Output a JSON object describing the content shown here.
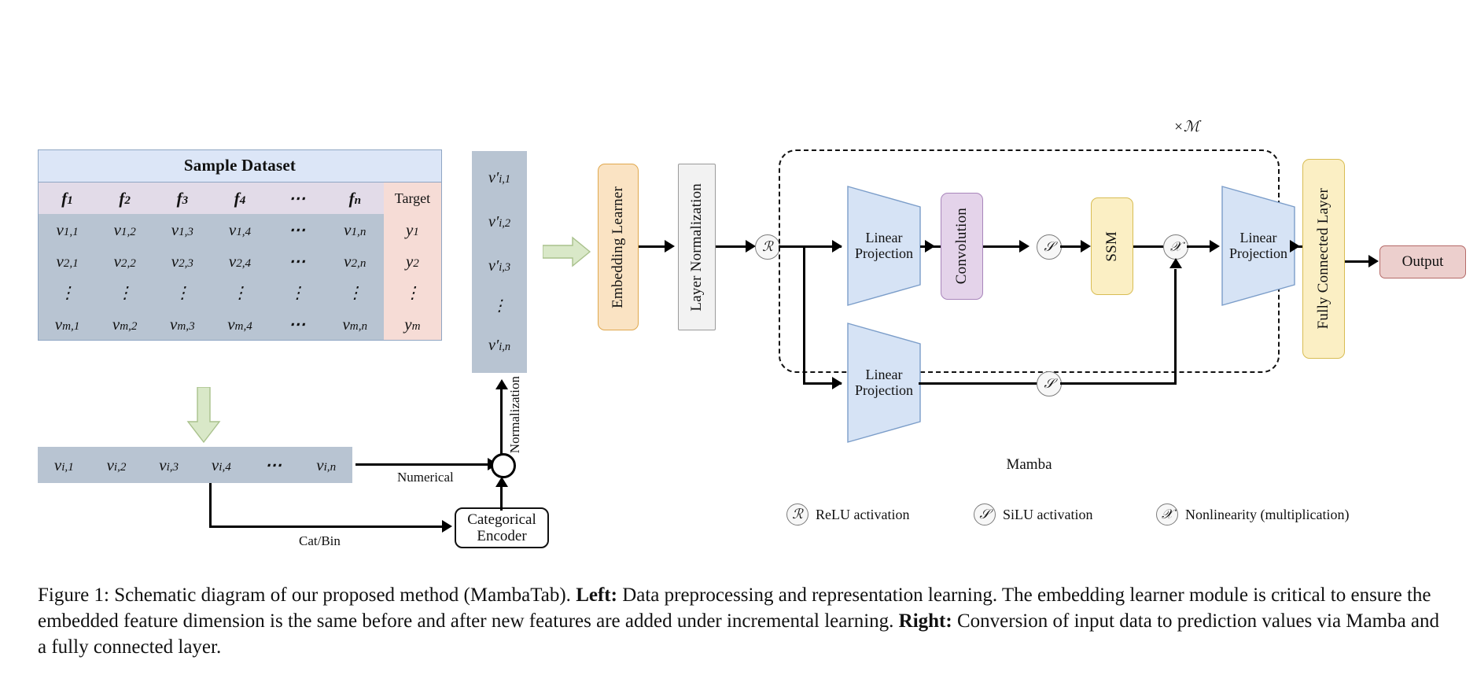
{
  "figure": {
    "caption_parts": {
      "lead": "Figure 1: Schematic diagram of our proposed method (MambaTab). ",
      "left_bold": "Left:",
      "left_text": " Data preprocessing and representation learning. The embedding learner module is critical to ensure the embedded feature dimension is the same before and after new features are added under incremental learning. ",
      "right_bold": "Right:",
      "right_text": " Conversion of input data to prediction values via Mamba and a fully connected layer."
    }
  },
  "dataset": {
    "title": "Sample Dataset",
    "feature_headers": [
      "f₁",
      "f₂",
      "f₃",
      "f₄",
      "⋯",
      "fₙ"
    ],
    "target_header": "Target",
    "rows": [
      {
        "values": [
          "v₁,₁",
          "v₁,₂",
          "v₁,₃",
          "v₁,₄",
          "⋯",
          "v₁,ₙ"
        ],
        "target": "y₁"
      },
      {
        "values": [
          "v₂,₁",
          "v₂,₂",
          "v₂,₃",
          "v₂,₄",
          "⋯",
          "v₂,ₙ"
        ],
        "target": "y₂"
      },
      {
        "values": [
          "⋮",
          "⋮",
          "⋮",
          "⋮",
          "⋮",
          "⋮"
        ],
        "target": "⋮"
      },
      {
        "values": [
          "vₘ,₁",
          "vₘ,₂",
          "vₘ,₃",
          "vₘ,₄",
          "⋯",
          "vₘ,ₙ"
        ],
        "target": "yₘ"
      }
    ]
  },
  "sample_row": {
    "cells": [
      "vᵢ,₁",
      "vᵢ,₂",
      "vᵢ,₃",
      "vᵢ,₄",
      "⋯",
      "vᵢ,ₙ"
    ]
  },
  "preprocess": {
    "numerical_label": "Numerical",
    "catbin_label": "Cat/Bin",
    "categorical_encoder_line1": "Categorical",
    "categorical_encoder_line2": "Encoder",
    "normalization_label": "Normalization"
  },
  "embedded_vector": {
    "cells": [
      "v′ᵢ,₁",
      "v′ᵢ,₂",
      "v′ᵢ,₃",
      "⋮",
      "v′ᵢ,ₙ"
    ]
  },
  "pipeline": {
    "embedding_learner": "Embedding Learner",
    "layer_normalization": "Layer Normalization",
    "relu_node": "ℛ",
    "linear_projection_top_l1": "Linear",
    "linear_projection_top_l2": "Projection",
    "linear_projection_bottom_l1": "Linear",
    "linear_projection_bottom_l2": "Projection",
    "convolution": "Convolution",
    "silu_node_top": "𝒮",
    "silu_node_bottom": "𝒮",
    "ssm": "SSM",
    "mult_node": "𝒳",
    "linear_projection_out_l1": "Linear",
    "linear_projection_out_l2": "Projection",
    "mamba_label": "Mamba",
    "repeat_label": "×ℳ",
    "fully_connected_layer": "Fully Connected Layer",
    "output": "Output"
  },
  "legend": {
    "items": [
      {
        "symbol": "ℛ",
        "label": "ReLU activation"
      },
      {
        "symbol": "𝒮",
        "label": "SiLU activation"
      },
      {
        "symbol": "𝒳",
        "label": "Nonlinearity (multiplication)"
      }
    ]
  },
  "colors": {
    "title_band": "#dce6f7",
    "feature_header": "#e2dbe8",
    "value_cells": "#b8c4d2",
    "target_cells": "#f6dcd6",
    "embedding_learner": "#fae3c3",
    "layer_norm": "#f2f2f2",
    "convolution": "#e4d3ea",
    "ssm": "#fbefc4",
    "linear_projection": "#d6e3f5",
    "fully_connected": "#fbefc4",
    "output": "#eccfcd",
    "green_arrow": "#d9e8c8"
  }
}
